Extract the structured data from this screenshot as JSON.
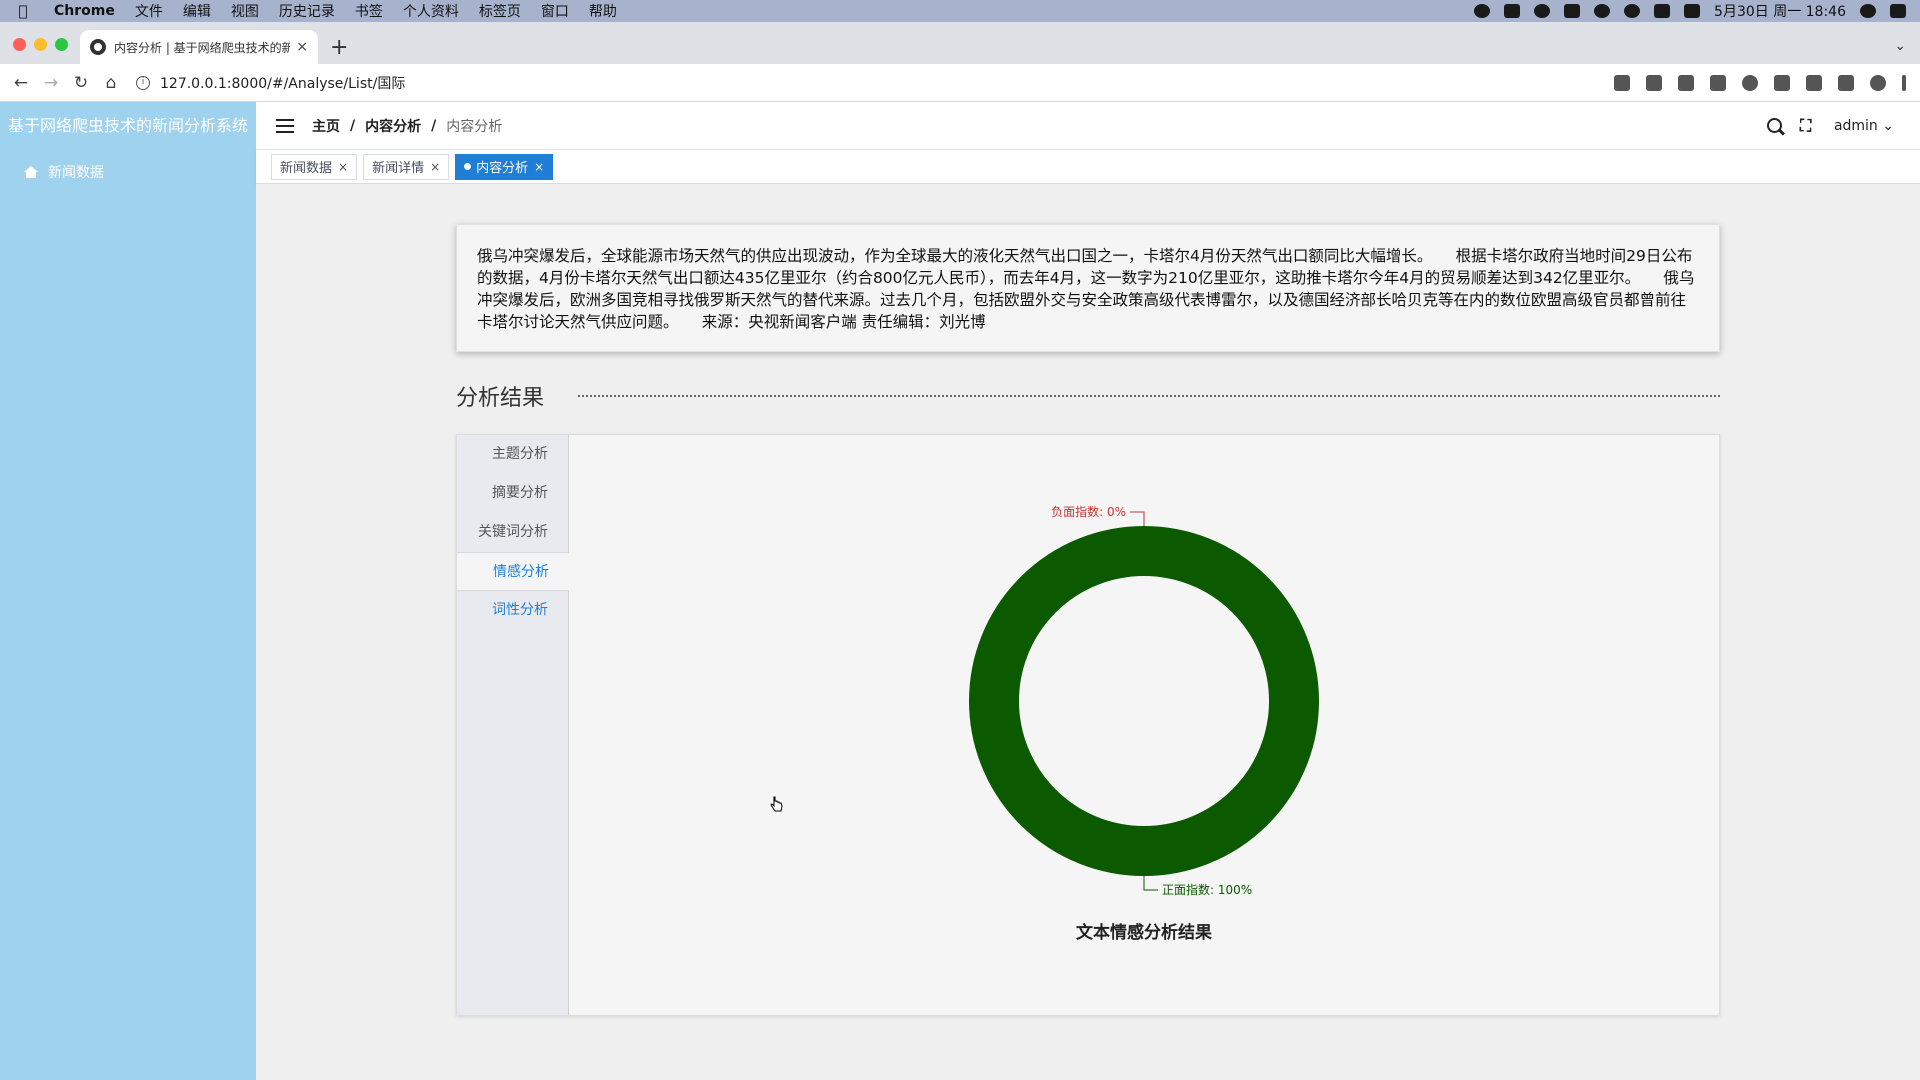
{
  "menubar": {
    "app": "Chrome",
    "items": [
      "文件",
      "编辑",
      "视图",
      "历史记录",
      "书签",
      "个人资料",
      "标签页",
      "窗口",
      "帮助"
    ],
    "clock": "5月30日 周一 18:46"
  },
  "browser": {
    "tab_title": "内容分析 | 基于网络爬虫技术的新",
    "url": "127.0.0.1:8000/#/Analyse/List/国际"
  },
  "app": {
    "brand": "基于网络爬虫技术的新闻分析系统",
    "sidebar_item": "新闻数据",
    "breadcrumb": [
      "主页",
      "内容分析",
      "内容分析"
    ],
    "breadcrumb_sep": "/",
    "user": "admin",
    "tags": [
      {
        "label": "新闻数据"
      },
      {
        "label": "新闻详情"
      },
      {
        "label": "内容分析"
      }
    ],
    "tag_close": "×"
  },
  "content": {
    "summary": "俄乌冲突爆发后，全球能源市场天然气的供应出现波动，作为全球最大的液化天然气出口国之一，卡塔尔4月份天然气出口额同比大幅增长。　　根据卡塔尔政府当地时间29日公布的数据，4月份卡塔尔天然气出口额达435亿里亚尔（约合800亿元人民币），而去年4月，这一数字为210亿里亚尔，这助推卡塔尔今年4月的贸易顺差达到342亿里亚尔。　　俄乌冲突爆发后，欧洲多国竞相寻找俄罗斯天然气的替代来源。过去几个月，包括欧盟外交与安全政策高级代表博雷尔，以及德国经济部长哈贝克等在内的数位欧盟高级官员都曾前往卡塔尔讨论天然气供应问题。　　来源：央视新闻客户端 责任编辑：刘光博",
    "section_title": "分析结果",
    "side_tabs": [
      "主题分析",
      "摘要分析",
      "关键词分析",
      "情感分析",
      "词性分析"
    ],
    "active_tab": 3
  },
  "chart_data": {
    "type": "pie",
    "title": "文本情感分析结果",
    "slices": [
      {
        "label": "负面指数: 0%",
        "value": 0,
        "color": "#c23531"
      },
      {
        "label": "正面指数: 100%",
        "value": 100,
        "color": "#0b5a00"
      }
    ]
  }
}
